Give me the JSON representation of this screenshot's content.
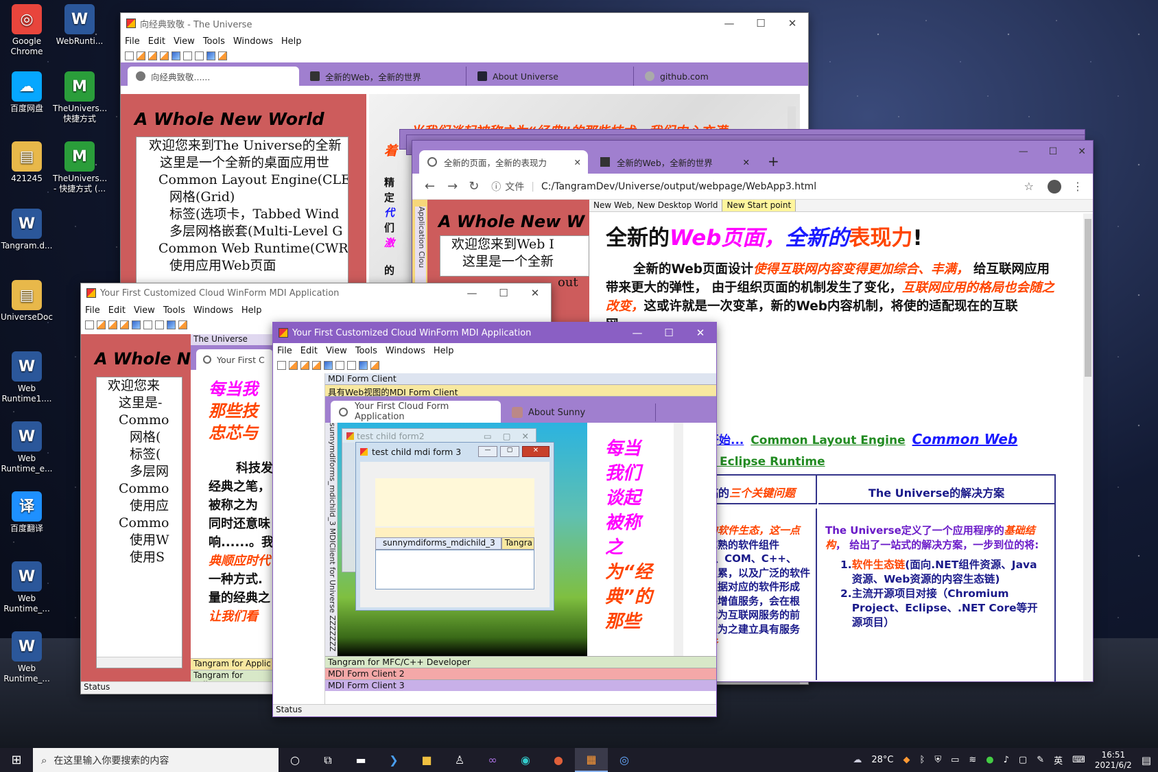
{
  "desktop": {
    "icons": [
      {
        "label": "Google Chrome",
        "icon": "chrome-icon",
        "color": "#e8453c"
      },
      {
        "label": "WebRunti...",
        "icon": "word-icon",
        "color": "#2b579a"
      },
      {
        "label": "百度网盘",
        "icon": "baidu-netdisk-icon",
        "color": "#06a7ff"
      },
      {
        "label": "TheUnivers... 快捷方式",
        "icon": "universe-shortcut-icon",
        "color": "#2a9d3a"
      },
      {
        "label": "421245",
        "icon": "folder-icon",
        "color": "#e8b84a"
      },
      {
        "label": "TheUnivers... - 快捷方式 (...",
        "icon": "universe-shortcut-icon",
        "color": "#2a9d3a"
      },
      {
        "label": "Tangram.d...",
        "icon": "word-icon",
        "color": "#2b579a"
      },
      {
        "label": "UniverseDoc",
        "icon": "folder-icon",
        "color": "#e8b84a"
      },
      {
        "label": "Web Runtime1....",
        "icon": "word-icon",
        "color": "#2b579a"
      },
      {
        "label": "Web Runtime_e...",
        "icon": "word-icon",
        "color": "#2b579a"
      },
      {
        "label": "百度翻译",
        "icon": "baidu-translate-icon",
        "color": "#1e90ff"
      },
      {
        "label": "Web Runtime_...",
        "icon": "word-icon",
        "color": "#2b579a"
      },
      {
        "label": "Web Runtime_...",
        "icon": "word-icon",
        "color": "#2b579a"
      }
    ]
  },
  "menu": [
    "File",
    "Edit",
    "View",
    "Tools",
    "Windows",
    "Help"
  ],
  "win_main": {
    "title": "向经典致敬 - The Universe",
    "tabs": [
      "向经典致敬......",
      "全新的Web，全新的世界",
      "About Universe",
      "github.com"
    ],
    "heading": "A Whole New World",
    "tree": [
      "欢迎您来到The Universe的全新",
      "这里是一个全新的桌面应用世",
      "Common Layout Engine(CLE)",
      "网格(Grid)",
      "标签(选项卡，Tabbed Wind",
      "多层网格嵌套(Multi-Level G",
      "Common Web Runtime(CWR",
      "使用应用Web页面"
    ],
    "banner_line1": "当我们谈起被称之为“经典”的那些技术，我们内心充满",
    "banner_line2": "着",
    "side_text": [
      "精",
      "定",
      "代",
      "们",
      "激",
      "的"
    ]
  },
  "win_browser": {
    "tabs": [
      "全新的页面，全新的表现力",
      "全新的Web，全新的世界"
    ],
    "new_tab": "+",
    "url_label": "文件",
    "url": "C:/TangramDev/Universe/output/webpage/WebApp3.html",
    "inner_tabs": [
      "New Web, New Desktop World",
      "New Start point"
    ],
    "side_vertical": [
      "Application",
      "Clou"
    ],
    "left_heading": "A Whole New W",
    "left_tree": [
      "欢迎您来到Web I",
      "这里是一个全新"
    ],
    "left_tail": "out",
    "page_title_a": "全新的",
    "page_title_b": "Web页面，",
    "page_title_c": "全新的",
    "page_title_d": "表现力",
    "page_title_e": "!",
    "para_a": "全新的Web页面设计",
    "para_b": "使得互联网内容变得更加综合、丰满，",
    "para_c": "给互联网应用带来更大的弹性， 由于组织页面的机制发生了变化，",
    "para_d": "互联网应用的格局也会随之改变，",
    "para_e": "这或许就是一次变革，新的Web内容机制，将使",
    "para_f": "的适配现在的互联网......",
    "links_a": "开始...",
    "links_b": "Common Layout Engine",
    "links_c": "Common Web",
    "links_d": "n Eclipse Runtime",
    "table_left_head_a": "临的",
    "table_left_head_b": "三个关键问题",
    "table_right_head": "The Universe的解决方案",
    "left_col": [
      "的软件生态，这一点",
      "成熟的软件组件",
      "a、COM、C++、",
      "积累，以及广泛的软件",
      "根据对应的软件形成",
      "件增值服务，会在根",
      "成为互联网服务的前",
      "以为之建立具有服务",
      "务"
    ],
    "right_intro_a": "The Universe定义了一个应用程序的",
    "right_intro_b": "基础结构",
    "right_intro_c": "， 给出了一站式的解决方案，一步到位的将:",
    "right_list": [
      {
        "num": "1.",
        "em": "软件生态链",
        "rest": "(面向.NET组件资源、Java资源、Web资源的内容生态链)"
      },
      {
        "num": "2.",
        "em": "",
        "rest": "主流开源项目对接（Chromium Project、Eclipse、.NET Core等开源项目）"
      }
    ]
  },
  "win_mdi1": {
    "title": "Your First Customized Cloud WinForm MDI Application",
    "heading": "A Whole N",
    "tree": [
      "欢迎您来",
      "这里是-",
      "Commo",
      "网格(",
      "标签(",
      "多层网",
      "Commo",
      "使用应",
      "Commo",
      "使用W",
      "使用S"
    ],
    "inner_label": "The Universe",
    "inner_tab": "Your First C",
    "pink_lines": [
      "每当我",
      "那些技",
      "忠芯与"
    ],
    "body_lines": [
      "科技发",
      "经典之笔，",
      "被称之为",
      "同时还意味",
      "响......。我",
      "典顺应时代",
      "一种方式.",
      "量的经典之",
      "让我们看"
    ],
    "bottom_panels": [
      "Tangram for Applic",
      "Tangram for Eclipse"
    ],
    "status": "Status"
  },
  "win_mdi2": {
    "title": "Your First Customized Cloud WinForm MDI Application",
    "client_labels": [
      "MDI Form Client",
      "具有Web视图的MDI Form Client"
    ],
    "tabs": [
      "Your First Cloud Form Application",
      "About Sunny"
    ],
    "vertical_label": "sunnymdiforms_mdichild_3  MDIClient for Universe  ZZZZZZZ",
    "child2_title": "test child form2",
    "child3_title": "test child mdi form 3",
    "child3_tabs": [
      "sunnymdiforms_mdichild_3",
      "Tangra"
    ],
    "right_pink_lines": [
      "每当",
      "我们",
      "谈起",
      "被称",
      "之",
      "为“经",
      "典”的",
      "那些"
    ],
    "bottom_panels": [
      "Tangram for MFC/C++ Developer",
      "MDI Form Client 2",
      "MDI Form Client 3"
    ],
    "status": "Status",
    "accent": "#8a5fc4"
  },
  "taskbar": {
    "search_placeholder": "在这里输入你要搜索的内容",
    "weather": "28°C",
    "ime": "英",
    "time": "16:51",
    "date": "2021/6/2"
  }
}
